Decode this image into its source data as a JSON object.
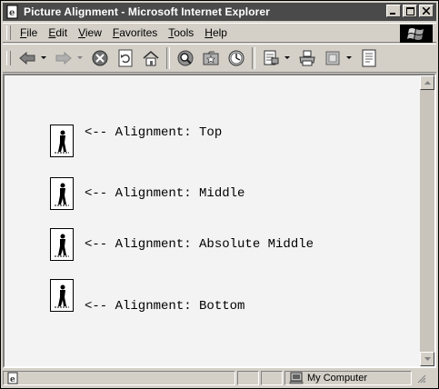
{
  "window": {
    "title": "Picture Alignment - Microsoft Internet Explorer"
  },
  "menubar": {
    "items": [
      {
        "label": "File",
        "accel": "F",
        "rest": "ile"
      },
      {
        "label": "Edit",
        "accel": "E",
        "rest": "dit"
      },
      {
        "label": "View",
        "accel": "V",
        "rest": "iew"
      },
      {
        "label": "Favorites",
        "accel": "F",
        "rest": "avorites"
      },
      {
        "label": "Tools",
        "accel": "T",
        "rest": "ools"
      },
      {
        "label": "Help",
        "accel": "H",
        "rest": "elp"
      }
    ]
  },
  "toolbar": {
    "buttons": [
      "back-icon",
      "forward-icon",
      "stop-icon",
      "refresh-icon",
      "home-icon",
      "search-icon",
      "favorites-icon",
      "history-icon",
      "mail-icon",
      "print-icon",
      "edit-icon",
      "discuss-icon"
    ]
  },
  "page": {
    "rows": [
      {
        "text": "<-- Alignment: Top"
      },
      {
        "text": "<-- Alignment: Middle"
      },
      {
        "text": "<-- Alignment: Absolute Middle"
      },
      {
        "text": "<-- Alignment: Bottom"
      }
    ]
  },
  "statusbar": {
    "zone": "My Computer"
  }
}
